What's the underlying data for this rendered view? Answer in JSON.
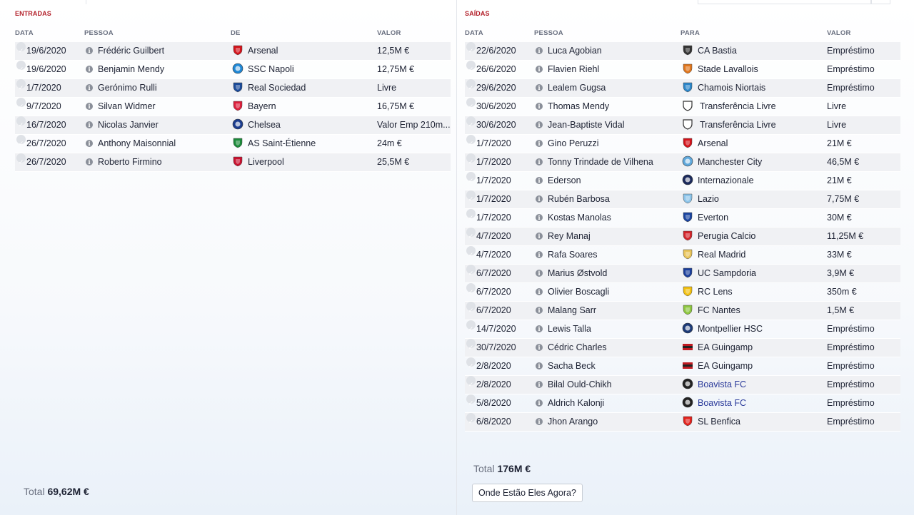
{
  "incoming": {
    "title": "ENTRADAS",
    "columns": [
      "DATA",
      "PESSOA",
      "DE",
      "VALOR"
    ],
    "rows": [
      {
        "date": "19/6/2020",
        "person": "Frédéric Guilbert",
        "club": "Arsenal",
        "club_icon": "arsenal-crest-icon",
        "crest_color": "#d3131b",
        "value": "12,5M €"
      },
      {
        "date": "19/6/2020",
        "person": "Benjamin Mendy",
        "club": "SSC Napoli",
        "club_icon": "napoli-crest-icon",
        "crest_color": "#1f88d6",
        "value": "12,75M €"
      },
      {
        "date": "1/7/2020",
        "person": "Gerónimo Rulli",
        "club": "Real Sociedad",
        "club_icon": "real-sociedad-crest-icon",
        "crest_color": "#1b4b9a",
        "value": "Livre"
      },
      {
        "date": "9/7/2020",
        "person": "Silvan Widmer",
        "club": "Bayern",
        "club_icon": "bayern-crest-icon",
        "crest_color": "#dc1f3c",
        "value": "16,75M €"
      },
      {
        "date": "16/7/2020",
        "person": "Nicolas Janvier",
        "club": "Chelsea",
        "club_icon": "chelsea-crest-icon",
        "crest_color": "#1c3d8f",
        "value": "Valor Emp 210m..."
      },
      {
        "date": "26/7/2020",
        "person": "Anthony Maisonnial",
        "club": "AS Saint-Étienne",
        "club_icon": "saint-etienne-crest-icon",
        "crest_color": "#1b8a3a",
        "value": "24m €"
      },
      {
        "date": "26/7/2020",
        "person": "Roberto Firmino",
        "club": "Liverpool",
        "club_icon": "liverpool-crest-icon",
        "crest_color": "#c8102e",
        "value": "25,5M €"
      }
    ],
    "total_label": "Total",
    "total_value": "69,62M €"
  },
  "outgoing": {
    "title": "SAÍDAS",
    "columns": [
      "DATA",
      "PESSOA",
      "PARA",
      "VALOR"
    ],
    "rows": [
      {
        "date": "22/6/2020",
        "person": "Luca Agobian",
        "club": "CA Bastia",
        "club_icon": "bastia-crest-icon",
        "crest_color": "#333333",
        "value": "Empréstimo"
      },
      {
        "date": "26/6/2020",
        "person": "Flavien Riehl",
        "club": "Stade Lavallois",
        "club_icon": "laval-crest-icon",
        "crest_color": "#e0761c",
        "value": "Empréstimo"
      },
      {
        "date": "29/6/2020",
        "person": "Lealem Gugsa",
        "club": "Chamois Niortais",
        "club_icon": "niort-crest-icon",
        "crest_color": "#2c86c9",
        "value": "Empréstimo"
      },
      {
        "date": "30/6/2020",
        "person": "Thomas Mendy",
        "club": "Transferência Livre",
        "club_icon": "shield-outline-icon",
        "crest_color": "#ffffff",
        "value": "Livre"
      },
      {
        "date": "30/6/2020",
        "person": "Jean-Baptiste Vidal",
        "club": "Transferência Livre",
        "club_icon": "shield-outline-icon",
        "crest_color": "#ffffff",
        "value": "Livre"
      },
      {
        "date": "1/7/2020",
        "person": "Gino Peruzzi",
        "club": "Arsenal",
        "club_icon": "arsenal-crest-icon",
        "crest_color": "#d3131b",
        "value": "21M €"
      },
      {
        "date": "1/7/2020",
        "person": "Tonny Trindade de Vilhena",
        "club": "Manchester City",
        "club_icon": "man-city-crest-icon",
        "crest_color": "#5fa8dc",
        "value": "46,5M €"
      },
      {
        "date": "1/7/2020",
        "person": "Ederson",
        "club": "Internazionale",
        "club_icon": "inter-crest-icon",
        "crest_color": "#1b2a5c",
        "value": "21M €"
      },
      {
        "date": "1/7/2020",
        "person": "Rubén Barbosa",
        "club": "Lazio",
        "club_icon": "lazio-crest-icon",
        "crest_color": "#8cc4ea",
        "value": "7,75M €"
      },
      {
        "date": "1/7/2020",
        "person": "Kostas Manolas",
        "club": "Everton",
        "club_icon": "everton-crest-icon",
        "crest_color": "#1a44a0",
        "value": "30M €"
      },
      {
        "date": "4/7/2020",
        "person": "Rey Manaj",
        "club": "Perugia Calcio",
        "club_icon": "perugia-crest-icon",
        "crest_color": "#d3252b",
        "value": "11,25M €"
      },
      {
        "date": "4/7/2020",
        "person": "Rafa Soares",
        "club": "Real Madrid",
        "club_icon": "real-madrid-crest-icon",
        "crest_color": "#e8c45a",
        "value": "33M €"
      },
      {
        "date": "6/7/2020",
        "person": "Marius Østvold",
        "club": "UC Sampdoria",
        "club_icon": "sampdoria-crest-icon",
        "crest_color": "#1b3f9c",
        "value": "3,9M €"
      },
      {
        "date": "6/7/2020",
        "person": "Olivier Boscagli",
        "club": "RC Lens",
        "club_icon": "lens-crest-icon",
        "crest_color": "#f2c010",
        "value": "350m €"
      },
      {
        "date": "6/7/2020",
        "person": "Malang Sarr",
        "club": "FC Nantes",
        "club_icon": "nantes-crest-icon",
        "crest_color": "#8dc63f",
        "value": "1,5M €"
      },
      {
        "date": "14/7/2020",
        "person": "Lewis Talla",
        "club": "Montpellier HSC",
        "club_icon": "montpellier-crest-icon",
        "crest_color": "#1c3a78",
        "value": "Empréstimo"
      },
      {
        "date": "30/7/2020",
        "person": "Cédric Charles",
        "club": "EA Guingamp",
        "club_icon": "guingamp-crest-icon",
        "crest_color": "#c01b22",
        "value": "Empréstimo"
      },
      {
        "date": "2/8/2020",
        "person": "Sacha Beck",
        "club": "EA Guingamp",
        "club_icon": "guingamp-crest-icon",
        "crest_color": "#c01b22",
        "value": "Empréstimo"
      },
      {
        "date": "2/8/2020",
        "person": "Bilal Ould-Chikh",
        "club": "Boavista FC",
        "club_icon": "boavista-crest-icon",
        "crest_color": "#222222",
        "value": "Empréstimo",
        "link": true
      },
      {
        "date": "5/8/2020",
        "person": "Aldrich Kalonji",
        "club": "Boavista FC",
        "club_icon": "boavista-crest-icon",
        "crest_color": "#222222",
        "value": "Empréstimo",
        "link": true
      },
      {
        "date": "6/8/2020",
        "person": "Jhon Arango",
        "club": "SL Benfica",
        "club_icon": "benfica-crest-icon",
        "crest_color": "#e2211c",
        "value": "Empréstimo"
      }
    ],
    "total_label": "Total",
    "total_value": "176M €",
    "where_button": "Onde Estão Eles Agora?"
  }
}
